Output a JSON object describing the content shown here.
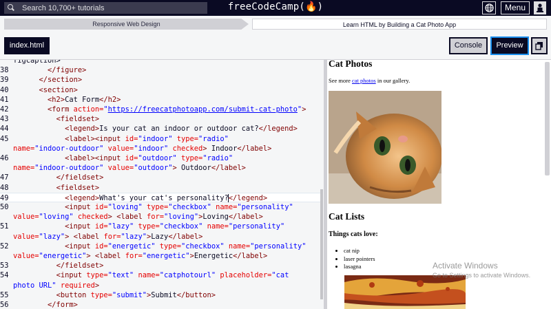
{
  "nav": {
    "search_placeholder": "Search 10,700+ tutorials",
    "brand": "freeCodeCamp",
    "brand_flame": "(🔥)",
    "menu_label": "Menu"
  },
  "breadcrumb": {
    "course": "Responsive Web Design",
    "project": "Learn HTML by Building a Cat Photo App"
  },
  "toolbar": {
    "file_tab": "index.html",
    "console_label": "Console",
    "preview_label": "Preview"
  },
  "editor": {
    "lines": [
      {
        "ln": "",
        "html": "<span class='p'>figcaption></span>"
      },
      {
        "ln": "38",
        "html": "        <span class='t'>&lt;/figure&gt;</span>"
      },
      {
        "ln": "39",
        "html": "      <span class='t'>&lt;/section&gt;</span>"
      },
      {
        "ln": "40",
        "html": "      <span class='t'>&lt;section&gt;</span>"
      },
      {
        "ln": "41",
        "html": "        <span class='t'>&lt;h2&gt;</span>Cat Form<span class='t'>&lt;/h2&gt;</span>"
      },
      {
        "ln": "42",
        "html": "        <span class='t'>&lt;form</span> <span class='a'>action=</span><span class='s'>\"<span class='lnk'>https://freecatphotoapp.com/submit-cat-photo</span>\"</span><span class='t'>&gt;</span>"
      },
      {
        "ln": "43",
        "html": "          <span class='t'>&lt;fieldset&gt;</span>"
      },
      {
        "ln": "44",
        "html": "            <span class='t'>&lt;legend&gt;</span>Is your cat an indoor or outdoor cat?<span class='t'>&lt;/legend&gt;</span>"
      },
      {
        "ln": "45",
        "html": "            <span class='t'>&lt;label&gt;&lt;input</span> <span class='a'>id=</span><span class='s'>\"indoor\"</span> <span class='a'>type=</span><span class='s'>\"radio\"</span>"
      },
      {
        "ln": "",
        "html": "<span class='a'>name=</span><span class='s'>\"indoor-outdoor\"</span> <span class='a'>value=</span><span class='s'>\"indoor\"</span> <span class='a'>checked</span><span class='t'>&gt;</span> Indoor<span class='t'>&lt;/label&gt;</span>"
      },
      {
        "ln": "46",
        "html": "            <span class='t'>&lt;label&gt;&lt;input</span> <span class='a'>id=</span><span class='s'>\"outdoor\"</span> <span class='a'>type=</span><span class='s'>\"radio\"</span>"
      },
      {
        "ln": "",
        "html": "<span class='a'>name=</span><span class='s'>\"indoor-outdoor\"</span> <span class='a'>value=</span><span class='s'>\"outdoor\"</span><span class='t'>&gt;</span> Outdoor<span class='t'>&lt;/label&gt;</span>"
      },
      {
        "ln": "47",
        "html": "          <span class='t'>&lt;/fieldset&gt;</span>"
      },
      {
        "ln": "48",
        "html": "          <span class='t'>&lt;fieldset&gt;</span>"
      },
      {
        "ln": "49",
        "html": "            <span class='t'>&lt;legend&gt;</span>What's your cat's personality?<span class='cursor'></span><span class='t'>&lt;/legend&gt;</span>",
        "active": true
      },
      {
        "ln": "50",
        "html": "            <span class='t'>&lt;input</span> <span class='a'>id=</span><span class='s'>\"loving\"</span> <span class='a'>type=</span><span class='s'>\"checkbox\"</span> <span class='a'>name=</span><span class='s'>\"personality\"</span>"
      },
      {
        "ln": "",
        "html": "<span class='a'>value=</span><span class='s'>\"loving\"</span> <span class='a'>checked</span><span class='t'>&gt;</span> <span class='t'>&lt;label</span> <span class='a'>for=</span><span class='s'>\"loving\"</span><span class='t'>&gt;</span>Loving<span class='t'>&lt;/label&gt;</span>"
      },
      {
        "ln": "51",
        "html": "            <span class='t'>&lt;input</span> <span class='a'>id=</span><span class='s'>\"lazy\"</span> <span class='a'>type=</span><span class='s'>\"checkbox\"</span> <span class='a'>name=</span><span class='s'>\"personality\"</span>"
      },
      {
        "ln": "",
        "html": "<span class='a'>value=</span><span class='s'>\"lazy\"</span><span class='t'>&gt;</span> <span class='t'>&lt;label</span> <span class='a'>for=</span><span class='s'>\"lazy\"</span><span class='t'>&gt;</span>Lazy<span class='t'>&lt;/label&gt;</span>"
      },
      {
        "ln": "52",
        "html": "            <span class='t'>&lt;input</span> <span class='a'>id=</span><span class='s'>\"energetic\"</span> <span class='a'>type=</span><span class='s'>\"checkbox\"</span> <span class='a'>name=</span><span class='s'>\"personality\"</span>"
      },
      {
        "ln": "",
        "html": "<span class='a'>value=</span><span class='s'>\"energetic\"</span><span class='t'>&gt;</span> <span class='t'>&lt;label</span> <span class='a'>for=</span><span class='s'>\"energetic\"</span><span class='t'>&gt;</span>Energetic<span class='t'>&lt;/label&gt;</span>"
      },
      {
        "ln": "53",
        "html": "          <span class='t'>&lt;/fieldset&gt;</span>"
      },
      {
        "ln": "54",
        "html": "          <span class='t'>&lt;input</span> <span class='a'>type=</span><span class='s'>\"text\"</span> <span class='a'>name=</span><span class='s'>\"catphotourl\"</span> <span class='a'>placeholder=</span><span class='s'>\"cat</span>"
      },
      {
        "ln": "",
        "html": "<span class='s'>photo URL\"</span> <span class='a'>required</span><span class='t'>&gt;</span>"
      },
      {
        "ln": "55",
        "html": "          <span class='t'>&lt;button</span> <span class='a'>type=</span><span class='s'>\"submit\"</span><span class='t'>&gt;</span>Submit<span class='t'>&lt;/button&gt;</span>"
      },
      {
        "ln": "56",
        "html": "        <span class='t'>&lt;/form&gt;</span>"
      }
    ]
  },
  "preview": {
    "heading_photos": "Cat Photos",
    "see_more_prefix": "See more ",
    "see_more_link": "cat photos",
    "see_more_suffix": " in our gallery.",
    "heading_lists": "Cat Lists",
    "things_love": "Things cats love:",
    "love_items": [
      "cat nip",
      "laser pointers",
      "lasagna"
    ]
  },
  "watermark": {
    "title": "Activate Windows",
    "subtitle": "Go to Settings to activate Windows."
  }
}
